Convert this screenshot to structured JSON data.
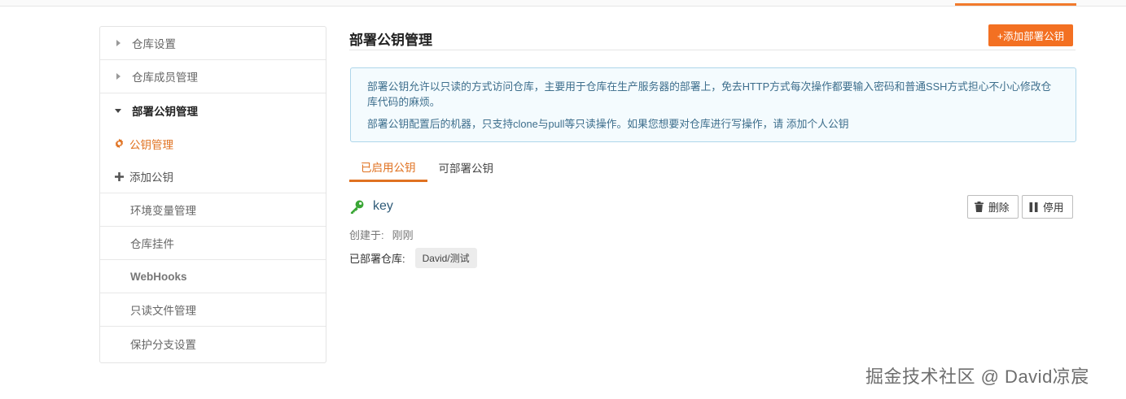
{
  "sidebar": {
    "items": [
      {
        "label": "仓库设置"
      },
      {
        "label": "仓库成员管理"
      },
      {
        "label": "部署公钥管理"
      },
      {
        "label": "环境变量管理"
      },
      {
        "label": "仓库挂件"
      },
      {
        "label": "WebHooks"
      },
      {
        "label": "只读文件管理"
      },
      {
        "label": "保护分支设置"
      }
    ],
    "subitems": [
      {
        "label": "公钥管理",
        "icon": "gear-icon"
      },
      {
        "label": "添加公钥",
        "icon": "plus-icon"
      }
    ]
  },
  "main": {
    "title": "部署公钥管理",
    "add_button": "+添加部署公钥",
    "notice": {
      "line1": "部署公钥允许以只读的方式访问仓库，主要用于仓库在生产服务器的部署上，免去HTTP方式每次操作都要输入密码和普通SSH方式担心不小心修改仓库代码的麻烦。",
      "line2_prefix": "部署公钥配置后的机器，只支持clone与pull等只读操作。如果您想要对仓库进行写操作，请 ",
      "line2_link": "添加个人公钥"
    },
    "tabs": [
      {
        "label": "已启用公钥"
      },
      {
        "label": "可部署公钥"
      }
    ],
    "key": {
      "name": "key",
      "created_label": "创建于:",
      "created_value": "刚刚",
      "deployed_label": "已部署仓库:",
      "repo": "David/测试",
      "delete_label": "删除",
      "disable_label": "停用"
    }
  },
  "watermark": "掘金技术社区 @ David凉宸",
  "colors": {
    "accent": "#f37022",
    "notice_bg": "#f4fbfe",
    "notice_border": "#aed6ea",
    "key_icon": "#3aa635"
  }
}
